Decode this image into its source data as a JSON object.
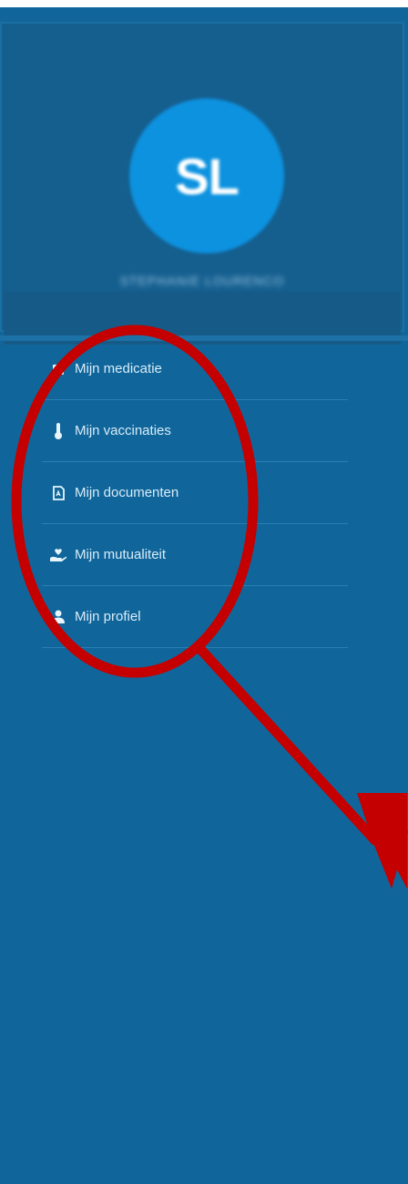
{
  "profile": {
    "initials": "SL",
    "name": "STEPHANIE LOURENCO"
  },
  "menu": {
    "items": [
      {
        "label": "Mijn medicatie",
        "icon": "medication-icon"
      },
      {
        "label": "Mijn vaccinaties",
        "icon": "thermometer-icon"
      },
      {
        "label": "Mijn documenten",
        "icon": "pdf-document-icon"
      },
      {
        "label": "Mijn mutualiteit",
        "icon": "hand-heart-icon"
      },
      {
        "label": "Mijn profiel",
        "icon": "user-icon"
      }
    ]
  },
  "colors": {
    "background": "#10669b",
    "avatar": "#0d92df",
    "annotation": "#c40000"
  }
}
